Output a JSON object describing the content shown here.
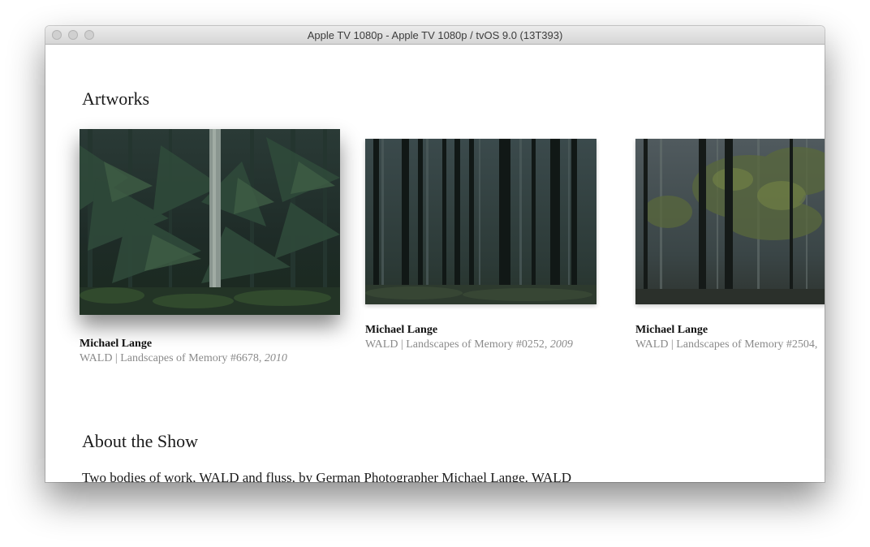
{
  "window": {
    "title": "Apple TV 1080p - Apple TV 1080p / tvOS 9.0 (13T393)"
  },
  "artworks": {
    "heading": "Artworks",
    "items": [
      {
        "artist": "Michael Lange",
        "title": "WALD | Landscapes of Memory #6678, ",
        "year": "2010",
        "image": "forest-fir-trees-photo",
        "focused": true
      },
      {
        "artist": "Michael Lange",
        "title": "WALD | Landscapes of Memory #0252, ",
        "year": "2009",
        "image": "forest-dark-trunks-photo",
        "focused": false
      },
      {
        "artist": "Michael Lange",
        "title": "WALD | Landscapes of Memory #2504, ",
        "year": "",
        "image": "forest-misty-green-photo",
        "focused": false
      }
    ]
  },
  "about": {
    "heading": "About the Show",
    "text": "Two bodies of work, WALD and fluss, by German Photographer Michael Lange.  WALD"
  },
  "colors": {
    "window_bg": "#ffffff",
    "titlebar": "#e0e0e0",
    "caption_gray": "#8a8a8a",
    "forest_dark": "#1d2a27"
  }
}
